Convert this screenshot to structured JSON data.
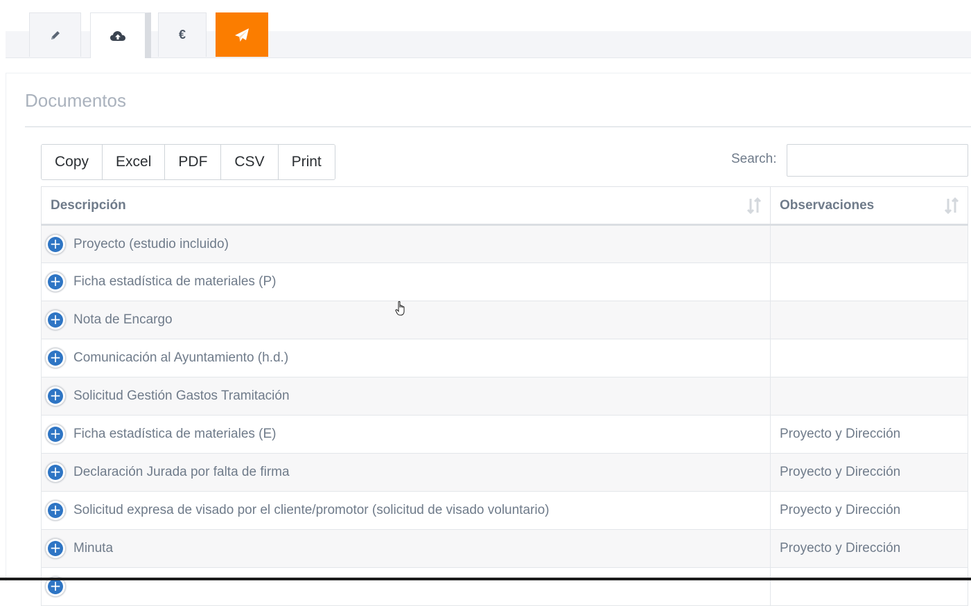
{
  "tabs": [
    {
      "name": "tab-edit",
      "icon": "pencil-icon",
      "label": ""
    },
    {
      "name": "tab-upload",
      "icon": "cloud-upload-icon",
      "label": ""
    },
    {
      "name": "tab-fees",
      "icon": "euro-icon",
      "label": "€"
    },
    {
      "name": "tab-send",
      "icon": "paper-plane-icon",
      "label": ""
    }
  ],
  "colors": {
    "accent": "#fb7d00",
    "expand_button": "#2e75c4",
    "text": "#6f7b8a",
    "title": "#aab2bd"
  },
  "panel": {
    "title": "Documentos"
  },
  "toolbar": {
    "copy_label": "Copy",
    "excel_label": "Excel",
    "pdf_label": "PDF",
    "csv_label": "CSV",
    "print_label": "Print"
  },
  "search": {
    "label": "Search:",
    "value": "",
    "placeholder": ""
  },
  "table": {
    "columns": [
      "Descripción",
      "Observaciones"
    ],
    "rows": [
      {
        "descripcion": "Proyecto (estudio incluido)",
        "observaciones": ""
      },
      {
        "descripcion": "Ficha estadística de materiales (P)",
        "observaciones": ""
      },
      {
        "descripcion": "Nota de Encargo",
        "observaciones": ""
      },
      {
        "descripcion": "Comunicación al Ayuntamiento (h.d.)",
        "observaciones": ""
      },
      {
        "descripcion": "Solicitud Gestión Gastos Tramitación",
        "observaciones": ""
      },
      {
        "descripcion": "Ficha estadística de materiales (E)",
        "observaciones": "Proyecto y Dirección"
      },
      {
        "descripcion": "Declaración Jurada por falta de firma",
        "observaciones": "Proyecto y Dirección"
      },
      {
        "descripcion": "Solicitud expresa de visado por el cliente/promotor (solicitud de visado voluntario)",
        "observaciones": "Proyecto y Dirección"
      },
      {
        "descripcion": "Minuta",
        "observaciones": "Proyecto y Dirección"
      },
      {
        "descripcion": "",
        "observaciones": ""
      }
    ]
  }
}
